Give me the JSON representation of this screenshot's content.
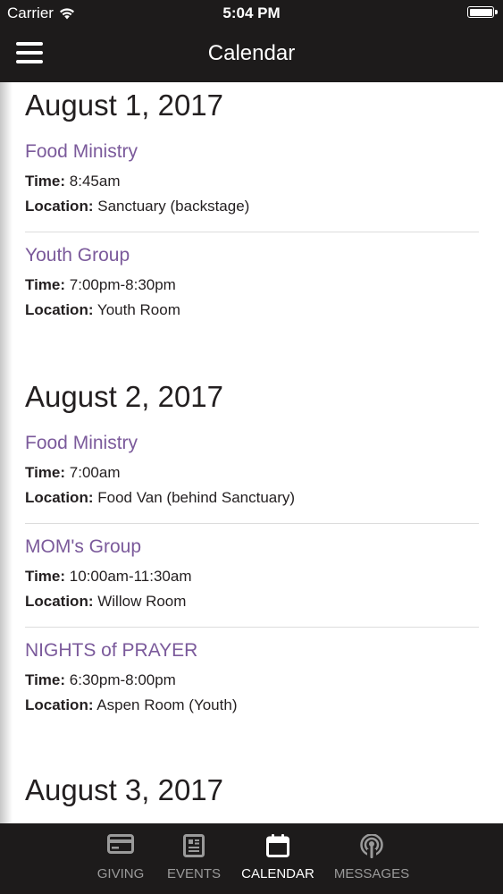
{
  "status_bar": {
    "carrier": "Carrier",
    "time": "5:04 PM"
  },
  "nav": {
    "title": "Calendar"
  },
  "days": [
    {
      "date": "August 1, 2017",
      "events": [
        {
          "title": "Food Ministry",
          "time_label": "Time:",
          "time": "8:45am",
          "location_label": "Location:",
          "location": "Sanctuary (backstage)"
        },
        {
          "title": "Youth Group",
          "time_label": "Time:",
          "time": "7:00pm-8:30pm",
          "location_label": "Location:",
          "location": "Youth Room"
        }
      ]
    },
    {
      "date": "August 2, 2017",
      "events": [
        {
          "title": "Food Ministry",
          "time_label": "Time:",
          "time": "7:00am",
          "location_label": "Location:",
          "location": "Food Van (behind Sanctuary)"
        },
        {
          "title": "MOM's Group",
          "time_label": "Time:",
          "time": "10:00am-11:30am",
          "location_label": "Location:",
          "location": "Willow Room"
        },
        {
          "title": "NIGHTS of PRAYER",
          "time_label": "Time:",
          "time": "6:30pm-8:00pm",
          "location_label": "Location:",
          "location": "Aspen Room (Youth)"
        }
      ]
    },
    {
      "date": "August 3, 2017",
      "events": []
    }
  ],
  "tabs": [
    {
      "label": "GIVING",
      "icon": "card-icon"
    },
    {
      "label": "EVENTS",
      "icon": "newspaper-icon"
    },
    {
      "label": "CALENDAR",
      "icon": "calendar-icon"
    },
    {
      "label": "MESSAGES",
      "icon": "podcast-icon"
    }
  ],
  "colors": {
    "bar_background": "#1d1b1b",
    "event_title": "#7b5a9b",
    "tab_inactive": "#9a9a9a",
    "tab_active": "#ffffff"
  }
}
